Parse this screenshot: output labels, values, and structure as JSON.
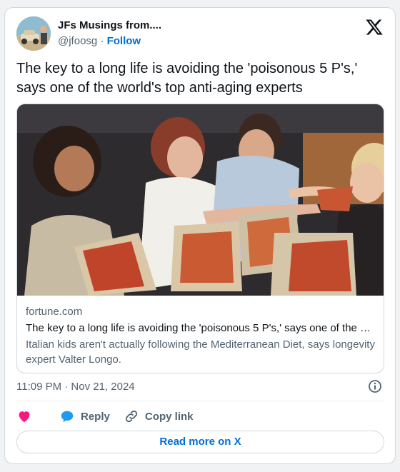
{
  "author": {
    "name": "JFs Musings from....",
    "handle": "@jfoosg",
    "separator": "·",
    "follow_label": "Follow"
  },
  "tweet": {
    "text": "The key to a long life is avoiding the 'poisonous 5 P's,' says one of the world's top anti-aging experts"
  },
  "link_card": {
    "domain": "fortune.com",
    "title": "The key to a long life is avoiding the 'poisonous 5 P's,' says one of the …",
    "description": "Italian kids aren't actually following the Mediterranean Diet, says longevity expert Valter Longo.",
    "image_subject": "friends-sharing-pizza-photo"
  },
  "meta": {
    "timestamp": "11:09 PM · Nov 21, 2024"
  },
  "actions": {
    "like_icon": "heart-icon",
    "reply_label": "Reply",
    "copy_link_label": "Copy link"
  },
  "read_more_label": "Read more on X",
  "colors": {
    "link_blue": "#006fd6",
    "heart": "#f91880",
    "secondary_text": "#536471",
    "border": "#cfd9de"
  }
}
